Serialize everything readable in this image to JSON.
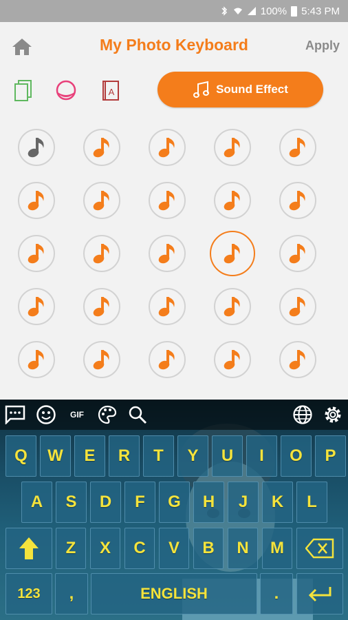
{
  "status": {
    "battery": "100%",
    "time": "5:43 PM"
  },
  "header": {
    "title": "My Photo Keyboard",
    "apply_label": "Apply"
  },
  "toolbar": {
    "sound_effect_label": "Sound Effect"
  },
  "colors": {
    "accent": "#f47d1b",
    "key_text": "#f4e33c"
  },
  "keyboard": {
    "top_icons": [
      "chat-icon",
      "emoji-icon",
      "gif-icon",
      "palette-icon",
      "search-icon",
      "globe-icon",
      "gear-icon"
    ],
    "gif_label": "GIF",
    "row1": [
      "Q",
      "W",
      "E",
      "R",
      "T",
      "Y",
      "U",
      "I",
      "O",
      "P"
    ],
    "row2": [
      "A",
      "S",
      "D",
      "F",
      "G",
      "H",
      "J",
      "K",
      "L"
    ],
    "row3": [
      "Z",
      "X",
      "C",
      "V",
      "B",
      "N",
      "M"
    ],
    "num_label": "123",
    "comma_label": ",",
    "space_label": "ENGLISH",
    "period_label": "."
  }
}
